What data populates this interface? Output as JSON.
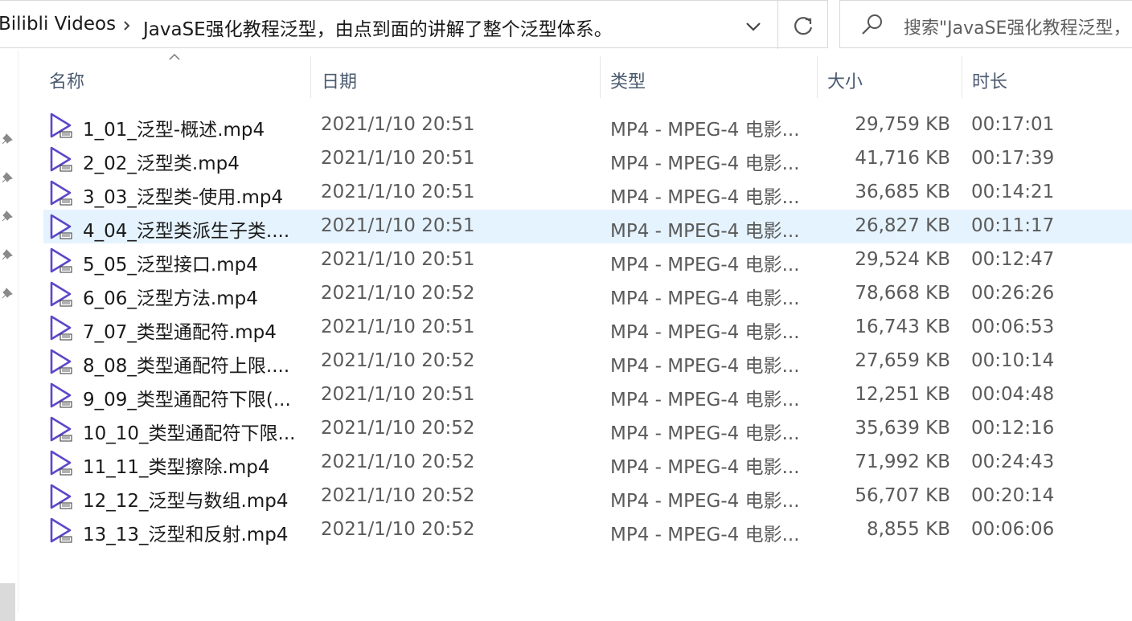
{
  "address_bar": {
    "breadcrumbs": [
      "Bilibli Videos",
      "JavaSE强化教程泛型，由点到面的讲解了整个泛型体系。"
    ]
  },
  "search": {
    "placeholder": "搜索\"JavaSE强化教程泛型，"
  },
  "columns": [
    {
      "label": "名称"
    },
    {
      "label": "日期"
    },
    {
      "label": "类型"
    },
    {
      "label": "大小"
    },
    {
      "label": "时长"
    }
  ],
  "files": [
    {
      "name": "1_01_泛型-概述.mp4",
      "date": "2021/1/10 20:51",
      "type": "MP4 - MPEG-4 电影...",
      "size": "29,759 KB",
      "duration": "00:17:01"
    },
    {
      "name": "2_02_泛型类.mp4",
      "date": "2021/1/10 20:51",
      "type": "MP4 - MPEG-4 电影...",
      "size": "41,716 KB",
      "duration": "00:17:39"
    },
    {
      "name": "3_03_泛型类-使用.mp4",
      "date": "2021/1/10 20:51",
      "type": "MP4 - MPEG-4 电影...",
      "size": "36,685 KB",
      "duration": "00:14:21"
    },
    {
      "name": "4_04_泛型类派生子类....",
      "date": "2021/1/10 20:51",
      "type": "MP4 - MPEG-4 电影...",
      "size": "26,827 KB",
      "duration": "00:11:17"
    },
    {
      "name": "5_05_泛型接口.mp4",
      "date": "2021/1/10 20:51",
      "type": "MP4 - MPEG-4 电影...",
      "size": "29,524 KB",
      "duration": "00:12:47"
    },
    {
      "name": "6_06_泛型方法.mp4",
      "date": "2021/1/10 20:52",
      "type": "MP4 - MPEG-4 电影...",
      "size": "78,668 KB",
      "duration": "00:26:26"
    },
    {
      "name": "7_07_类型通配符.mp4",
      "date": "2021/1/10 20:51",
      "type": "MP4 - MPEG-4 电影...",
      "size": "16,743 KB",
      "duration": "00:06:53"
    },
    {
      "name": "8_08_类型通配符上限....",
      "date": "2021/1/10 20:52",
      "type": "MP4 - MPEG-4 电影...",
      "size": "27,659 KB",
      "duration": "00:10:14"
    },
    {
      "name": "9_09_类型通配符下限(...",
      "date": "2021/1/10 20:51",
      "type": "MP4 - MPEG-4 电影...",
      "size": "12,251 KB",
      "duration": "00:04:48"
    },
    {
      "name": "10_10_类型通配符下限...",
      "date": "2021/1/10 20:52",
      "type": "MP4 - MPEG-4 电影...",
      "size": "35,639 KB",
      "duration": "00:12:16"
    },
    {
      "name": "11_11_类型擦除.mp4",
      "date": "2021/1/10 20:52",
      "type": "MP4 - MPEG-4 电影...",
      "size": "71,992 KB",
      "duration": "00:24:43"
    },
    {
      "name": "12_12_泛型与数组.mp4",
      "date": "2021/1/10 20:52",
      "type": "MP4 - MPEG-4 电影...",
      "size": "56,707 KB",
      "duration": "00:20:14"
    },
    {
      "name": "13_13_泛型和反射.mp4",
      "date": "2021/1/10 20:52",
      "type": "MP4 - MPEG-4 电影...",
      "size": "8,855 KB",
      "duration": "00:06:06"
    }
  ],
  "selected_index": 3,
  "sort": {
    "column": "名称",
    "direction": "ascending"
  },
  "colors": {
    "accent": "#5b48c9",
    "selection": "#e5f3fe",
    "header_text": "#4a5a70"
  },
  "icons": {
    "file": "video-file-icon",
    "pin": "pin-icon"
  }
}
